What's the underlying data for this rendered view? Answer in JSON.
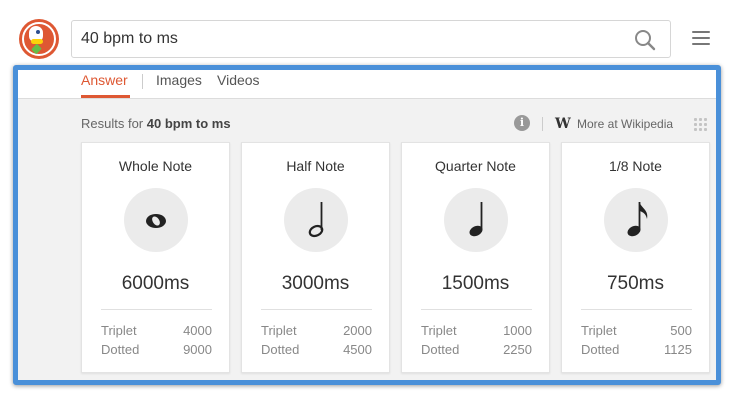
{
  "search": {
    "query": "40 bpm to ms"
  },
  "tabs": [
    {
      "label": "Answer",
      "active": true
    },
    {
      "label": "Images",
      "active": false
    },
    {
      "label": "Videos",
      "active": false
    }
  ],
  "results": {
    "prefix": "Results for",
    "query": "40 bpm to ms"
  },
  "meta": {
    "info_glyph": "i",
    "wiki_glyph": "W",
    "wiki_link": "More at Wikipedia"
  },
  "notes": [
    {
      "title": "Whole Note",
      "icon": "whole-note-icon",
      "ms": "6000ms",
      "triplet_label": "Triplet",
      "triplet": "4000",
      "dotted_label": "Dotted",
      "dotted": "9000"
    },
    {
      "title": "Half Note",
      "icon": "half-note-icon",
      "ms": "3000ms",
      "triplet_label": "Triplet",
      "triplet": "2000",
      "dotted_label": "Dotted",
      "dotted": "4500"
    },
    {
      "title": "Quarter Note",
      "icon": "quarter-note-icon",
      "ms": "1500ms",
      "triplet_label": "Triplet",
      "triplet": "1000",
      "dotted_label": "Dotted",
      "dotted": "2250"
    },
    {
      "title": "1/8 Note",
      "icon": "eighth-note-icon",
      "ms": "750ms",
      "triplet_label": "Triplet",
      "triplet": "500",
      "dotted_label": "Dotted",
      "dotted": "1125"
    }
  ],
  "colors": {
    "accent": "#de5833",
    "highlight_border": "#4a90d9",
    "panel_bg": "#f2f2f2"
  }
}
